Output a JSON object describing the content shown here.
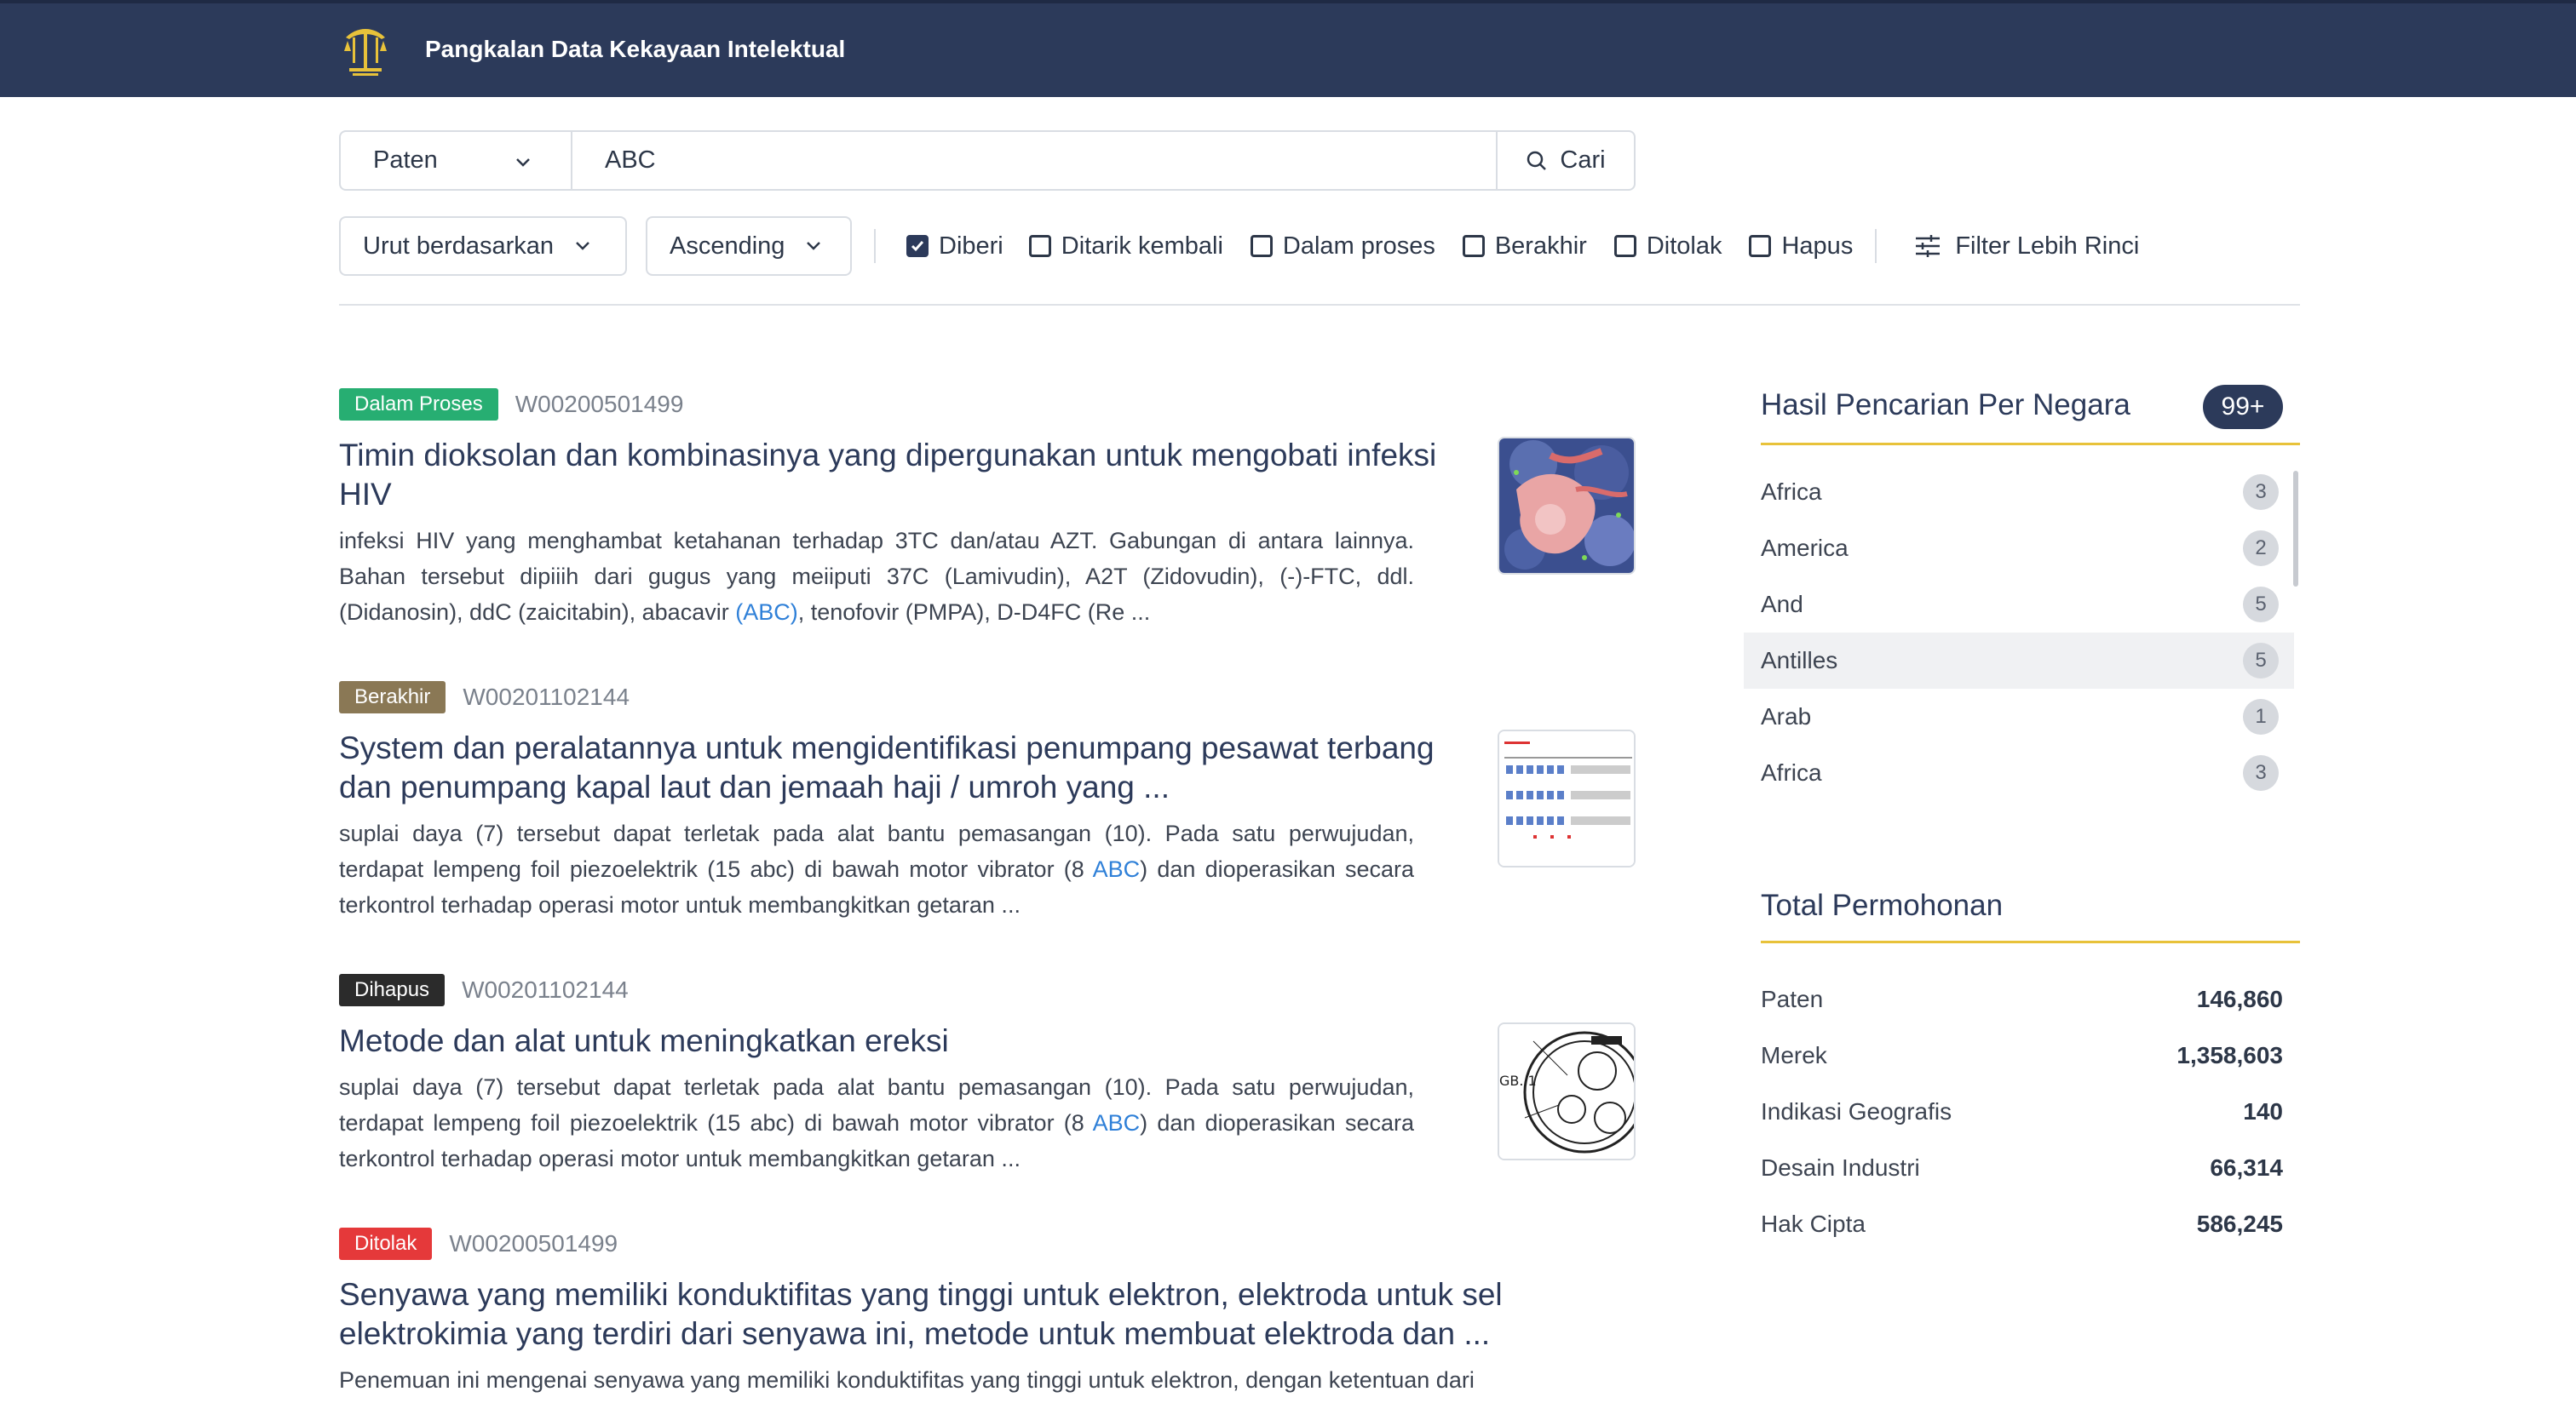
{
  "header": {
    "title": "Pangkalan Data Kekayaan Intelektual"
  },
  "search": {
    "type_selected": "Paten",
    "query": "ABC",
    "button_label": "Cari"
  },
  "filters": {
    "sort_label": "Urut berdasarkan",
    "order_label": "Ascending",
    "checkboxes": [
      {
        "label": "Diberi",
        "checked": true
      },
      {
        "label": "Ditarik kembali",
        "checked": false
      },
      {
        "label": "Dalam proses",
        "checked": false
      },
      {
        "label": "Berakhir",
        "checked": false
      },
      {
        "label": "Ditolak",
        "checked": false
      },
      {
        "label": "Hapus",
        "checked": false
      }
    ],
    "more_label": "Filter Lebih Rinci"
  },
  "results": [
    {
      "status": "Dalam Proses",
      "status_color": "#27ae72",
      "id": "W00200501499",
      "title": "Timin dioksolan dan kombinasinya yang dipergunakan untuk mengobati infeksi HIV",
      "snippet_before": " infeksi HIV yang menghambat ketahanan terhadap 3TC dan/atau AZT. Gabungan di antara lainnya. Bahan tersebut dipiiih dari gugus yang meiiputi 37C (Lamivudin), A2T (Zidovudin), (-)-FTC, ddl. (Didanosin), ddC (zaicitabin), abacavir ",
      "highlight": "(ABC)",
      "snippet_after": ", tenofovir (PMPA), D-D4FC (Re ..."
    },
    {
      "status": "Berakhir",
      "status_color": "#8a7855",
      "id": "W00201102144",
      "title": "System dan peralatannya untuk mengidentifikasi penumpang pesawat terbang dan penumpang kapal laut dan jemaah haji / umroh yang ...",
      "snippet_before": "suplai daya (7) tersebut dapat terletak pada alat bantu pemasangan (10). Pada satu perwujudan, terdapat lempeng foil piezoelektrik (15 abc) di bawah motor vibrator (8 ",
      "highlight": "ABC",
      "snippet_after": ") dan dioperasikan secara terkontrol terhadap operasi motor untuk membangkitkan getaran ..."
    },
    {
      "status": "Dihapus",
      "status_color": "#2b2b2b",
      "id": "W00201102144",
      "title": "Metode dan alat untuk meningkatkan ereksi",
      "snippet_before": "suplai daya (7) tersebut dapat terletak pada alat bantu pemasangan (10). Pada satu perwujudan, terdapat lempeng foil piezoelektrik (15 abc) di bawah motor vibrator (8 ",
      "highlight": "ABC",
      "snippet_after": ") dan dioperasikan secara terkontrol terhadap operasi motor untuk membangkitkan getaran ..."
    },
    {
      "status": "Ditolak",
      "status_color": "#e5393a",
      "id": "W00200501499",
      "title": "Senyawa yang memiliki konduktifitas yang tinggi untuk elektron, elektroda untuk sel elektrokimia yang terdiri dari senyawa ini, metode untuk membuat elektroda dan ...",
      "snippet_before": "Penemuan ini mengenai senyawa yang memiliki konduktifitas yang tinggi untuk elektron, dengan ketentuan dari",
      "highlight": "",
      "snippet_after": ""
    }
  ],
  "thumb_labels": {
    "fig": "GB. 1"
  },
  "sidebar": {
    "country_title": "Hasil Pencarian Per Negara",
    "country_badge": "99+",
    "countries": [
      {
        "name": "Africa",
        "count": "3"
      },
      {
        "name": "America",
        "count": "2"
      },
      {
        "name": "And",
        "count": "5"
      },
      {
        "name": "Antilles",
        "count": "5"
      },
      {
        "name": "Arab",
        "count": "1"
      },
      {
        "name": "Africa",
        "count": "3"
      }
    ],
    "total_title": "Total Permohonan",
    "totals": [
      {
        "label": "Paten",
        "value": "146,860"
      },
      {
        "label": "Merek",
        "value": "1,358,603"
      },
      {
        "label": "Indikasi Geografis",
        "value": "140"
      },
      {
        "label": "Desain Industri",
        "value": "66,314"
      },
      {
        "label": "Hak Cipta",
        "value": "586,245"
      }
    ]
  },
  "colors": {
    "header_bg": "#2c3a5a",
    "accent_gold": "#e8c23a",
    "link": "#2f80d8"
  }
}
